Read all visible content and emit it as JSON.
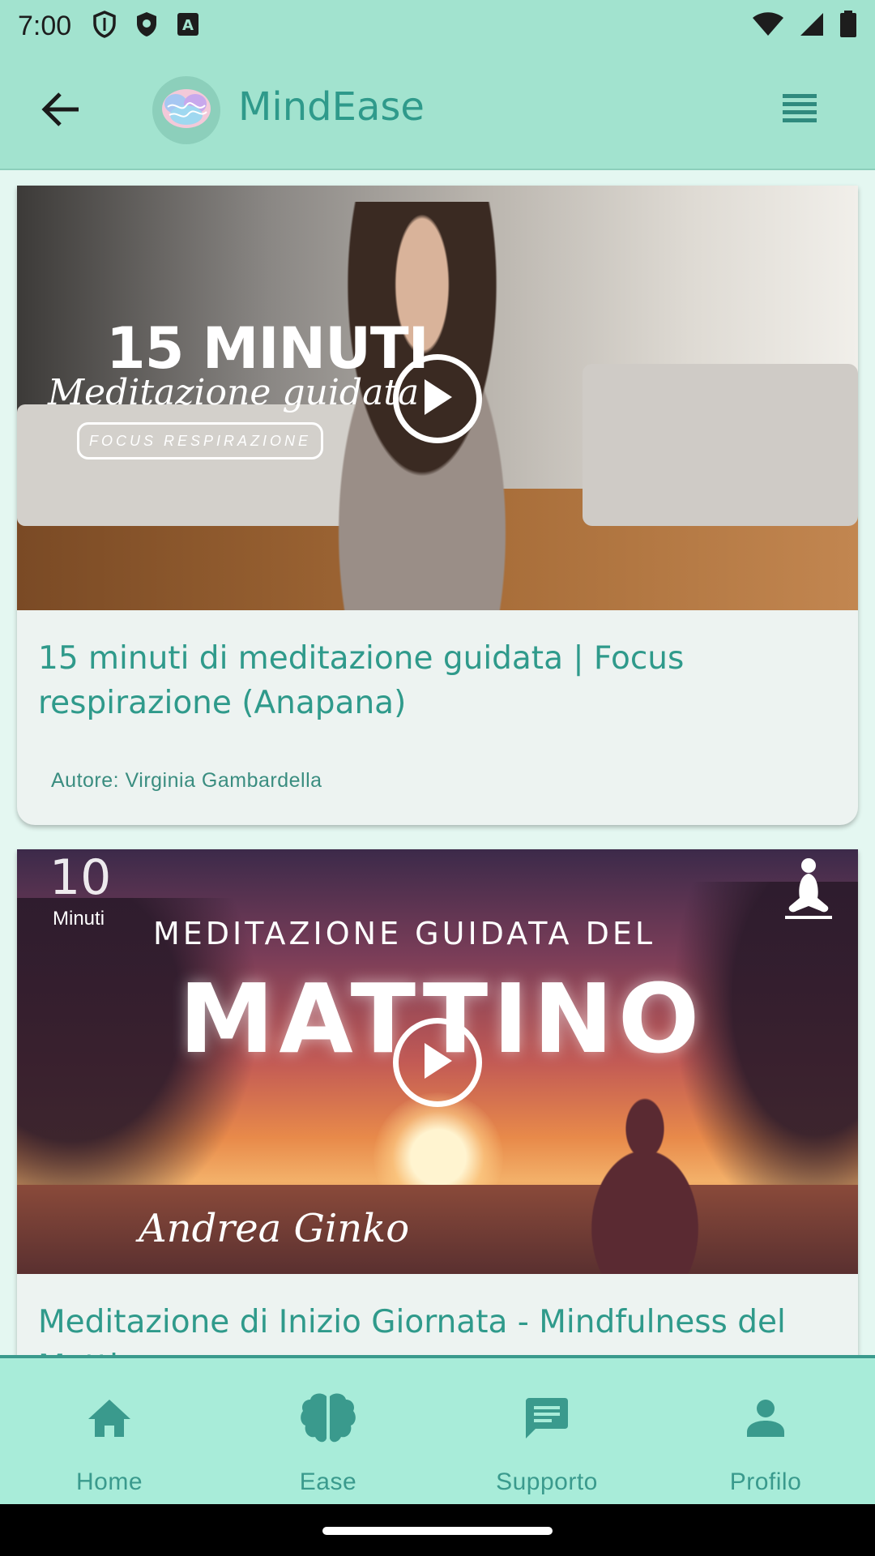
{
  "status_bar": {
    "time": "7:00",
    "icons_left": [
      "shield-outline-icon",
      "shield-filled-icon",
      "keyboard-a-icon"
    ],
    "icons_right": [
      "wifi-icon",
      "cell-signal-icon",
      "battery-icon"
    ]
  },
  "app_bar": {
    "title": "MindEase",
    "back_icon": "arrow-back-icon",
    "logo_icon": "brain-logo-icon",
    "menu_icon": "list-menu-icon"
  },
  "cards": [
    {
      "thumbnail": {
        "big_text": "15 MINUTI",
        "script_text": "Meditazione guidata",
        "pill_text": "FOCUS RESPIRAZIONE"
      },
      "title": "15 minuti di meditazione guidata | Focus respirazione (Anapana)",
      "author": "Autore: Virginia Gambardella"
    },
    {
      "thumbnail": {
        "number_text": "10",
        "minutes_text": "Minuti",
        "headline_text": "MEDITAZIONE GUIDATA DEL",
        "big_text": "MATTINO",
        "author_script": "Andrea Ginko"
      },
      "title": "Meditazione di Inizio Giornata - Mindfulness del Mattino"
    }
  ],
  "bottom_nav": {
    "items": [
      {
        "label": "Home",
        "icon": "home-icon"
      },
      {
        "label": "Ease",
        "icon": "brain-icon"
      },
      {
        "label": "Supporto",
        "icon": "chat-icon"
      },
      {
        "label": "Profilo",
        "icon": "person-icon"
      }
    ]
  },
  "colors": {
    "accent": "#2f9a8b",
    "app_bar_bg": "#a2e3cf",
    "nav_bg": "#a8ecd9",
    "page_bg": "#e4f7f1"
  }
}
